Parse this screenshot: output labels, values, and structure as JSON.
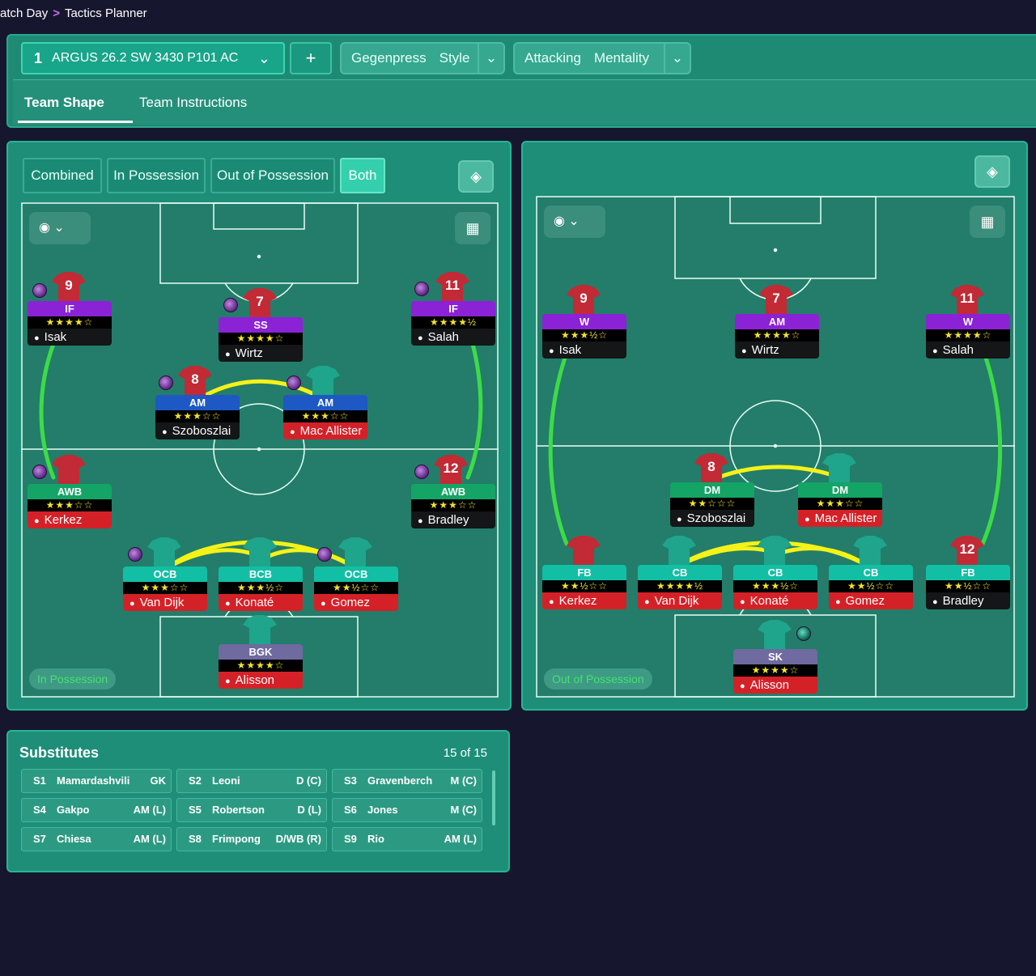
{
  "breadcrumb": {
    "parent": "atch Day",
    "current": "Tactics Planner"
  },
  "tactic": {
    "number": "1",
    "name": "ARGUS 26.2 SW 3430 P101 AC"
  },
  "style": {
    "value": "Gegenpress",
    "label": "Style"
  },
  "mentality": {
    "value": "Attacking",
    "label": "Mentality"
  },
  "tabs": [
    "Team Shape",
    "Team Instructions"
  ],
  "modes": [
    "Combined",
    "In Possession",
    "Out of Possession",
    "Both"
  ],
  "left_pitch": {
    "label": "In Possession",
    "players": [
      {
        "num": "9",
        "role": "IF",
        "rating": "★★★★☆",
        "name": "Isak"
      },
      {
        "num": "7",
        "role": "SS",
        "rating": "★★★★☆",
        "name": "Wirtz"
      },
      {
        "num": "11",
        "role": "IF",
        "rating": "★★★★½",
        "name": "Salah"
      },
      {
        "num": "8",
        "role": "AM",
        "rating": "★★★☆☆",
        "name": "Szoboszlai"
      },
      {
        "num": "",
        "role": "AM",
        "rating": "★★★☆☆",
        "name": "Mac Allister"
      },
      {
        "num": "",
        "role": "AWB",
        "rating": "★★★☆☆",
        "name": "Kerkez"
      },
      {
        "num": "12",
        "role": "AWB",
        "rating": "★★★☆☆",
        "name": "Bradley"
      },
      {
        "num": "",
        "role": "OCB",
        "rating": "★★★☆☆",
        "name": "Van Dijk"
      },
      {
        "num": "",
        "role": "BCB",
        "rating": "★★★½☆",
        "name": "Konaté"
      },
      {
        "num": "",
        "role": "OCB",
        "rating": "★★½☆☆",
        "name": "Gomez"
      },
      {
        "num": "",
        "role": "BGK",
        "rating": "★★★★☆",
        "name": "Alisson"
      }
    ]
  },
  "right_pitch": {
    "label": "Out of Possession",
    "players": [
      {
        "num": "9",
        "role": "W",
        "rating": "★★★½☆",
        "name": "Isak"
      },
      {
        "num": "7",
        "role": "AM",
        "rating": "★★★★☆",
        "name": "Wirtz"
      },
      {
        "num": "11",
        "role": "W",
        "rating": "★★★★☆",
        "name": "Salah"
      },
      {
        "num": "8",
        "role": "DM",
        "rating": "★★☆☆☆",
        "name": "Szoboszlai"
      },
      {
        "num": "",
        "role": "DM",
        "rating": "★★★☆☆",
        "name": "Mac Allister"
      },
      {
        "num": "",
        "role": "FB",
        "rating": "★★½☆☆",
        "name": "Kerkez"
      },
      {
        "num": "",
        "role": "CB",
        "rating": "★★★★½",
        "name": "Van Dijk"
      },
      {
        "num": "",
        "role": "CB",
        "rating": "★★★½☆",
        "name": "Konaté"
      },
      {
        "num": "",
        "role": "CB",
        "rating": "★★½☆☆",
        "name": "Gomez"
      },
      {
        "num": "12",
        "role": "FB",
        "rating": "★★½☆☆",
        "name": "Bradley"
      },
      {
        "num": "",
        "role": "SK",
        "rating": "★★★★☆",
        "name": "Alisson"
      }
    ]
  },
  "substitutes": {
    "title": "Substitutes",
    "count": "15 of 15",
    "list": [
      {
        "id": "S1",
        "name": "Mamardashvili",
        "pos": "GK"
      },
      {
        "id": "S2",
        "name": "Leoni",
        "pos": "D (C)"
      },
      {
        "id": "S3",
        "name": "Gravenberch",
        "pos": "M (C)"
      },
      {
        "id": "S4",
        "name": "Gakpo",
        "pos": "AM (L)"
      },
      {
        "id": "S5",
        "name": "Robertson",
        "pos": "D (L)"
      },
      {
        "id": "S6",
        "name": "Jones",
        "pos": "M (C)"
      },
      {
        "id": "S7",
        "name": "Chiesa",
        "pos": "AM (L)"
      },
      {
        "id": "S8",
        "name": "Frimpong",
        "pos": "D/WB (R)"
      },
      {
        "id": "S9",
        "name": "Rio",
        "pos": "AM (L)"
      }
    ]
  },
  "icons": {
    "eye": "eye-icon",
    "grid": "grid-icon",
    "pitch": "pitch-icon",
    "chevron": "chevron-down-icon",
    "add": "plus-icon"
  }
}
